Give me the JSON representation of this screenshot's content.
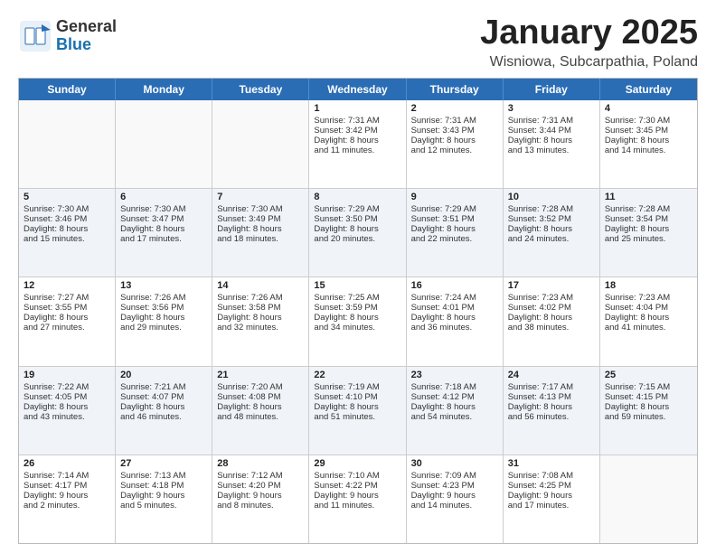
{
  "logo": {
    "text_general": "General",
    "text_blue": "Blue"
  },
  "header": {
    "month": "January 2025",
    "location": "Wisniowa, Subcarpathia, Poland"
  },
  "days": [
    "Sunday",
    "Monday",
    "Tuesday",
    "Wednesday",
    "Thursday",
    "Friday",
    "Saturday"
  ],
  "rows": [
    [
      {
        "day": "",
        "empty": true,
        "lines": []
      },
      {
        "day": "",
        "empty": true,
        "lines": []
      },
      {
        "day": "",
        "empty": true,
        "lines": []
      },
      {
        "day": "1",
        "empty": false,
        "lines": [
          "Sunrise: 7:31 AM",
          "Sunset: 3:42 PM",
          "Daylight: 8 hours",
          "and 11 minutes."
        ]
      },
      {
        "day": "2",
        "empty": false,
        "lines": [
          "Sunrise: 7:31 AM",
          "Sunset: 3:43 PM",
          "Daylight: 8 hours",
          "and 12 minutes."
        ]
      },
      {
        "day": "3",
        "empty": false,
        "lines": [
          "Sunrise: 7:31 AM",
          "Sunset: 3:44 PM",
          "Daylight: 8 hours",
          "and 13 minutes."
        ]
      },
      {
        "day": "4",
        "empty": false,
        "lines": [
          "Sunrise: 7:30 AM",
          "Sunset: 3:45 PM",
          "Daylight: 8 hours",
          "and 14 minutes."
        ]
      }
    ],
    [
      {
        "day": "5",
        "empty": false,
        "lines": [
          "Sunrise: 7:30 AM",
          "Sunset: 3:46 PM",
          "Daylight: 8 hours",
          "and 15 minutes."
        ]
      },
      {
        "day": "6",
        "empty": false,
        "lines": [
          "Sunrise: 7:30 AM",
          "Sunset: 3:47 PM",
          "Daylight: 8 hours",
          "and 17 minutes."
        ]
      },
      {
        "day": "7",
        "empty": false,
        "lines": [
          "Sunrise: 7:30 AM",
          "Sunset: 3:49 PM",
          "Daylight: 8 hours",
          "and 18 minutes."
        ]
      },
      {
        "day": "8",
        "empty": false,
        "lines": [
          "Sunrise: 7:29 AM",
          "Sunset: 3:50 PM",
          "Daylight: 8 hours",
          "and 20 minutes."
        ]
      },
      {
        "day": "9",
        "empty": false,
        "lines": [
          "Sunrise: 7:29 AM",
          "Sunset: 3:51 PM",
          "Daylight: 8 hours",
          "and 22 minutes."
        ]
      },
      {
        "day": "10",
        "empty": false,
        "lines": [
          "Sunrise: 7:28 AM",
          "Sunset: 3:52 PM",
          "Daylight: 8 hours",
          "and 24 minutes."
        ]
      },
      {
        "day": "11",
        "empty": false,
        "lines": [
          "Sunrise: 7:28 AM",
          "Sunset: 3:54 PM",
          "Daylight: 8 hours",
          "and 25 minutes."
        ]
      }
    ],
    [
      {
        "day": "12",
        "empty": false,
        "lines": [
          "Sunrise: 7:27 AM",
          "Sunset: 3:55 PM",
          "Daylight: 8 hours",
          "and 27 minutes."
        ]
      },
      {
        "day": "13",
        "empty": false,
        "lines": [
          "Sunrise: 7:26 AM",
          "Sunset: 3:56 PM",
          "Daylight: 8 hours",
          "and 29 minutes."
        ]
      },
      {
        "day": "14",
        "empty": false,
        "lines": [
          "Sunrise: 7:26 AM",
          "Sunset: 3:58 PM",
          "Daylight: 8 hours",
          "and 32 minutes."
        ]
      },
      {
        "day": "15",
        "empty": false,
        "lines": [
          "Sunrise: 7:25 AM",
          "Sunset: 3:59 PM",
          "Daylight: 8 hours",
          "and 34 minutes."
        ]
      },
      {
        "day": "16",
        "empty": false,
        "lines": [
          "Sunrise: 7:24 AM",
          "Sunset: 4:01 PM",
          "Daylight: 8 hours",
          "and 36 minutes."
        ]
      },
      {
        "day": "17",
        "empty": false,
        "lines": [
          "Sunrise: 7:23 AM",
          "Sunset: 4:02 PM",
          "Daylight: 8 hours",
          "and 38 minutes."
        ]
      },
      {
        "day": "18",
        "empty": false,
        "lines": [
          "Sunrise: 7:23 AM",
          "Sunset: 4:04 PM",
          "Daylight: 8 hours",
          "and 41 minutes."
        ]
      }
    ],
    [
      {
        "day": "19",
        "empty": false,
        "lines": [
          "Sunrise: 7:22 AM",
          "Sunset: 4:05 PM",
          "Daylight: 8 hours",
          "and 43 minutes."
        ]
      },
      {
        "day": "20",
        "empty": false,
        "lines": [
          "Sunrise: 7:21 AM",
          "Sunset: 4:07 PM",
          "Daylight: 8 hours",
          "and 46 minutes."
        ]
      },
      {
        "day": "21",
        "empty": false,
        "lines": [
          "Sunrise: 7:20 AM",
          "Sunset: 4:08 PM",
          "Daylight: 8 hours",
          "and 48 minutes."
        ]
      },
      {
        "day": "22",
        "empty": false,
        "lines": [
          "Sunrise: 7:19 AM",
          "Sunset: 4:10 PM",
          "Daylight: 8 hours",
          "and 51 minutes."
        ]
      },
      {
        "day": "23",
        "empty": false,
        "lines": [
          "Sunrise: 7:18 AM",
          "Sunset: 4:12 PM",
          "Daylight: 8 hours",
          "and 54 minutes."
        ]
      },
      {
        "day": "24",
        "empty": false,
        "lines": [
          "Sunrise: 7:17 AM",
          "Sunset: 4:13 PM",
          "Daylight: 8 hours",
          "and 56 minutes."
        ]
      },
      {
        "day": "25",
        "empty": false,
        "lines": [
          "Sunrise: 7:15 AM",
          "Sunset: 4:15 PM",
          "Daylight: 8 hours",
          "and 59 minutes."
        ]
      }
    ],
    [
      {
        "day": "26",
        "empty": false,
        "lines": [
          "Sunrise: 7:14 AM",
          "Sunset: 4:17 PM",
          "Daylight: 9 hours",
          "and 2 minutes."
        ]
      },
      {
        "day": "27",
        "empty": false,
        "lines": [
          "Sunrise: 7:13 AM",
          "Sunset: 4:18 PM",
          "Daylight: 9 hours",
          "and 5 minutes."
        ]
      },
      {
        "day": "28",
        "empty": false,
        "lines": [
          "Sunrise: 7:12 AM",
          "Sunset: 4:20 PM",
          "Daylight: 9 hours",
          "and 8 minutes."
        ]
      },
      {
        "day": "29",
        "empty": false,
        "lines": [
          "Sunrise: 7:10 AM",
          "Sunset: 4:22 PM",
          "Daylight: 9 hours",
          "and 11 minutes."
        ]
      },
      {
        "day": "30",
        "empty": false,
        "lines": [
          "Sunrise: 7:09 AM",
          "Sunset: 4:23 PM",
          "Daylight: 9 hours",
          "and 14 minutes."
        ]
      },
      {
        "day": "31",
        "empty": false,
        "lines": [
          "Sunrise: 7:08 AM",
          "Sunset: 4:25 PM",
          "Daylight: 9 hours",
          "and 17 minutes."
        ]
      },
      {
        "day": "",
        "empty": true,
        "lines": []
      }
    ]
  ]
}
